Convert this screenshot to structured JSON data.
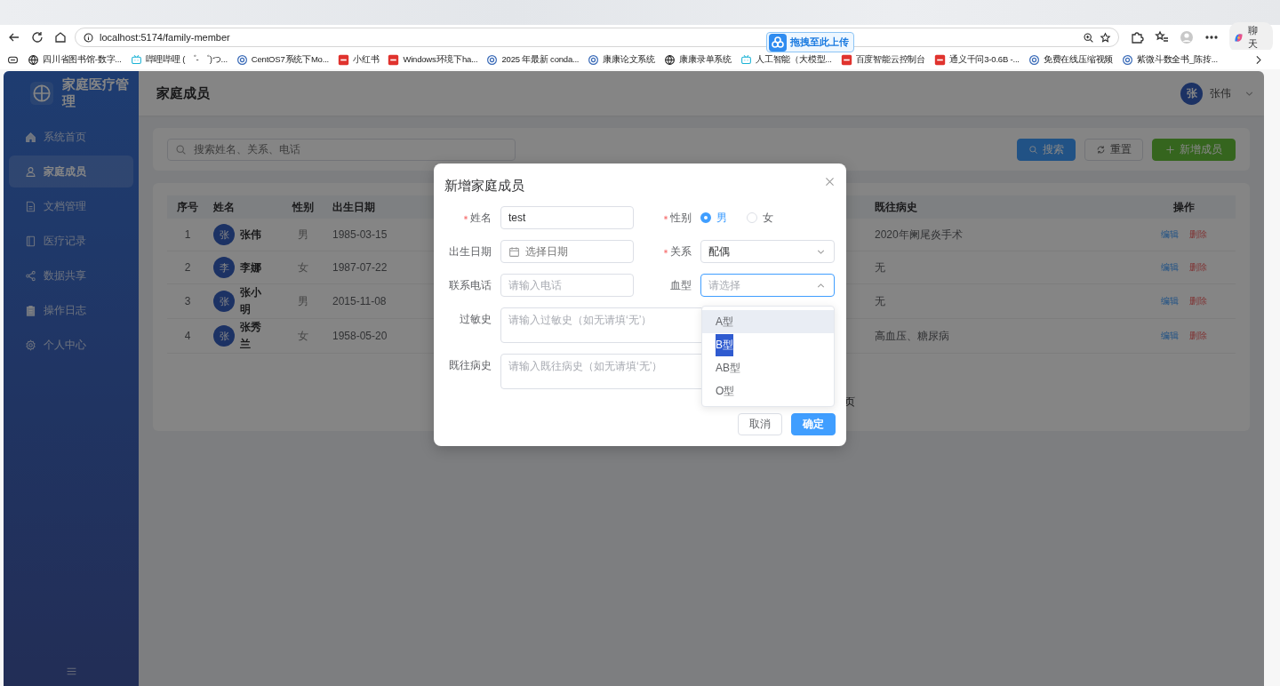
{
  "browser": {
    "url": "localhost:5174/family-member",
    "upload_badge": "拖拽至此上传",
    "chat_button": "聊天",
    "bookmarks": [
      {
        "kind": "globe",
        "label": "四川省图书馆-数字..."
      },
      {
        "kind": "tv",
        "label": "哔哩哔哩 ( ゜- ゜)つ..."
      },
      {
        "kind": "round",
        "label": "CentOS7系统下Mo..."
      },
      {
        "kind": "square",
        "label": "小红书"
      },
      {
        "kind": "square",
        "label": "Windows环境下ha..."
      },
      {
        "kind": "round",
        "label": "2025 年最新 conda..."
      },
      {
        "kind": "round",
        "label": "康康论文系统"
      },
      {
        "kind": "globe",
        "label": "康康录单系统"
      },
      {
        "kind": "tv",
        "label": "人工智能（大模型..."
      },
      {
        "kind": "square",
        "label": "百度智能云控制台"
      },
      {
        "kind": "square",
        "label": "通义千问3-0.6B -..."
      },
      {
        "kind": "round",
        "label": "免费在线压缩视频"
      },
      {
        "kind": "round",
        "label": "紫微斗数全书_陈抟..."
      }
    ]
  },
  "sidebar": {
    "title": "家庭医疗管理",
    "items": [
      {
        "kind": "home",
        "label": "系统首页",
        "selected": false
      },
      {
        "kind": "user",
        "label": "家庭成员",
        "selected": true
      },
      {
        "kind": "document",
        "label": "文档管理",
        "selected": false
      },
      {
        "kind": "book",
        "label": "医疗记录",
        "selected": false
      },
      {
        "kind": "share",
        "label": "数据共享",
        "selected": false
      },
      {
        "kind": "clipboard",
        "label": "操作日志",
        "selected": false
      },
      {
        "kind": "gear",
        "label": "个人中心",
        "selected": false
      }
    ]
  },
  "header": {
    "title": "家庭成员",
    "user": {
      "avatar": "张",
      "name": "张伟"
    }
  },
  "search": {
    "placeholder": "搜索姓名、关系、电话",
    "buttons": [
      {
        "kind": "primary",
        "label": "搜索"
      },
      {
        "kind": "reset",
        "label": "重置"
      },
      {
        "kind": "add",
        "label": "新增成员"
      }
    ]
  },
  "table": {
    "columns": [
      "序号",
      "姓名",
      "性别",
      "出生日期",
      "既往病史",
      "操作"
    ],
    "rows": [
      {
        "index": "1",
        "avatar": "张",
        "name": "张伟",
        "gender": "男",
        "birth_date": "1985-03-15",
        "history": "2020年阑尾炎手术",
        "actions": [
          "编辑",
          "删除"
        ]
      },
      {
        "index": "2",
        "avatar": "李",
        "name": "李娜",
        "gender": "女",
        "birth_date": "1987-07-22",
        "history": "无",
        "actions": [
          "编辑",
          "删除"
        ]
      },
      {
        "index": "3",
        "avatar": "张",
        "name": "张小明",
        "gender": "男",
        "birth_date": "2015-11-08",
        "history": "无",
        "actions": [
          "编辑",
          "删除"
        ]
      },
      {
        "index": "4",
        "avatar": "张",
        "name": "张秀兰",
        "gender": "女",
        "birth_date": "1958-05-20",
        "history": "高血压、糖尿病",
        "actions": [
          "编辑",
          "删除"
        ]
      }
    ],
    "pagination_tail": "页"
  },
  "dialog": {
    "title": "新增家庭成员",
    "fields": [
      {
        "kind": "input",
        "label": "姓名",
        "required": true,
        "value": "test"
      },
      {
        "kind": "radio",
        "label": "性别",
        "required": true,
        "options": [
          {
            "label": "男",
            "selected": true
          },
          {
            "label": "女",
            "selected": false
          }
        ]
      },
      {
        "kind": "date",
        "label": "出生日期",
        "required": false,
        "placeholder": "选择日期"
      },
      {
        "kind": "select",
        "label": "关系",
        "required": true,
        "value": "配偶",
        "open": false
      },
      {
        "kind": "input",
        "label": "联系电话",
        "required": false,
        "placeholder": "请输入电话"
      },
      {
        "kind": "select",
        "label": "血型",
        "required": false,
        "placeholder": "请选择",
        "open": true,
        "options": [
          {
            "label": "A型",
            "selected": false,
            "hovered": true,
            "text_selected": false
          },
          {
            "label": "B型",
            "selected": false,
            "hovered": false,
            "text_selected": true
          },
          {
            "label": "AB型",
            "selected": false,
            "hovered": false,
            "text_selected": false
          },
          {
            "label": "O型",
            "selected": false,
            "hovered": false,
            "text_selected": false
          }
        ]
      },
      {
        "kind": "textarea",
        "label": "过敏史",
        "required": false,
        "placeholder": "请输入过敏史（如无请填‘无’）"
      },
      {
        "kind": "textarea",
        "label": "既往病史",
        "required": false,
        "placeholder": "请输入既往病史（如无请填‘无’）"
      }
    ],
    "buttons": [
      {
        "kind": "cancel",
        "label": "取消"
      },
      {
        "kind": "confirm",
        "label": "确定"
      }
    ]
  }
}
